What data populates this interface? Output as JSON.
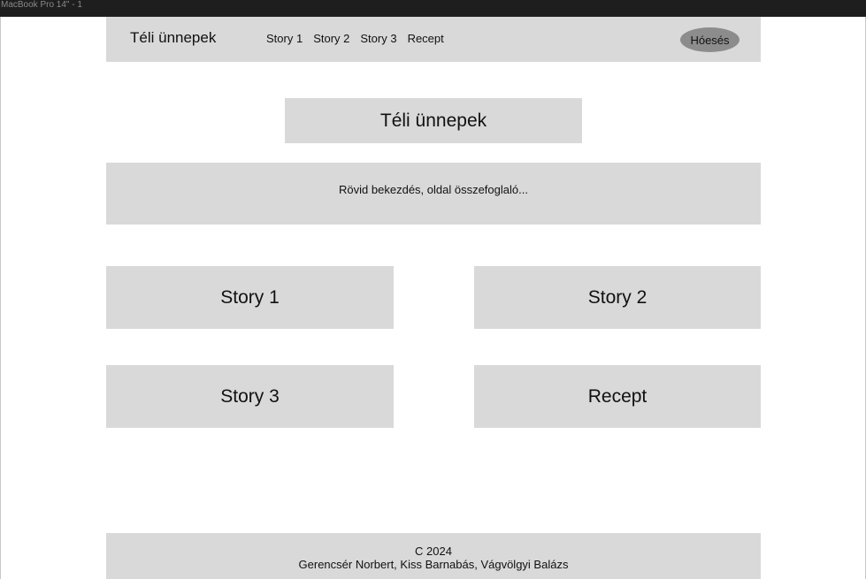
{
  "frame": {
    "title": "MacBook Pro 14\" - 1"
  },
  "header": {
    "brand": "Téli ünnepek",
    "nav": [
      "Story 1",
      "Story 2",
      "Story 3",
      "Recept"
    ],
    "snow_button": "Hóesés"
  },
  "hero": {
    "title": "Téli ünnepek"
  },
  "summary": {
    "text": "Rövid bekezdés, oldal összefoglaló..."
  },
  "cards": [
    "Story 1",
    "Story 2",
    "Story 3",
    "Recept"
  ],
  "footer": {
    "copyright": "C 2024",
    "authors": "Gerencsér Norbert, Kiss Barnabás, Vágvölgyi Balázs"
  }
}
